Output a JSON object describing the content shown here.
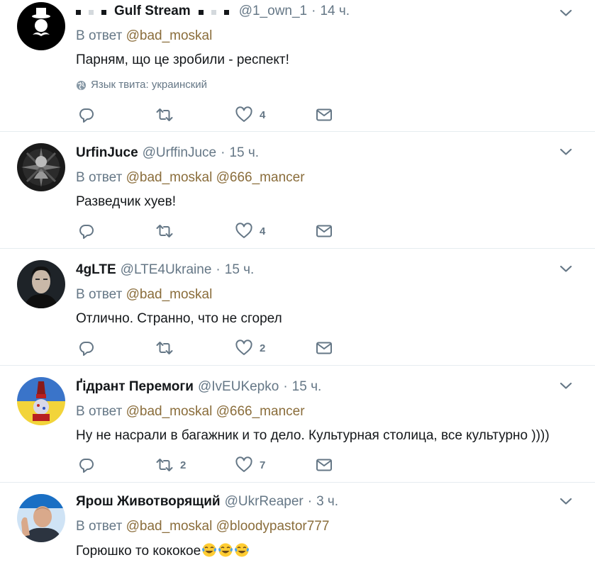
{
  "tweets": [
    {
      "fullname": "Gulf Stream",
      "username": "@1_own_1",
      "time": "14 ч.",
      "reply_prefix": "В ответ",
      "reply_mentions": "@bad_moskal",
      "text": "Парням, що це зробили - респект!",
      "lang_label": "Язык твита: украинский",
      "replies": "",
      "retweets": "",
      "likes": "4"
    },
    {
      "fullname": "UrfinJuce",
      "username": "@UrffinJuce",
      "time": "15 ч.",
      "reply_prefix": "В ответ",
      "reply_mentions": "@bad_moskal @666_mancer",
      "text": "Разведчик хуев!",
      "replies": "",
      "retweets": "",
      "likes": "4"
    },
    {
      "fullname": "4gLTE",
      "username": "@LTE4Ukraine",
      "time": "15 ч.",
      "reply_prefix": "В ответ",
      "reply_mentions": "@bad_moskal",
      "text": "Отлично. Странно, что не сгорел",
      "replies": "",
      "retweets": "",
      "likes": "2"
    },
    {
      "fullname": "Ґідрант Перемоги",
      "username": "@IvEUKepko",
      "time": "15 ч.",
      "reply_prefix": "В ответ",
      "reply_mentions": "@bad_moskal @666_mancer",
      "text": "Ну не насрали в багажник и то дело. Культурная столица, все культурно ))))",
      "replies": "",
      "retweets": "2",
      "likes": "7"
    },
    {
      "fullname": "Ярош Животворящий",
      "username": "@UkrReaper",
      "time": "3 ч.",
      "reply_prefix": "В ответ",
      "reply_mentions": "@bad_moskal @bloodypastor777",
      "text": "Горюшко то кококое"
    }
  ],
  "icons": {
    "reply": "reply-icon",
    "retweet": "retweet-icon",
    "like": "heart-icon",
    "dm": "envelope-icon",
    "more": "chevron-down-icon",
    "lang": "globe-icon",
    "emoji": "tears-of-joy-emoji"
  },
  "colors": {
    "text": "#14171a",
    "secondary": "#657786",
    "mention": "#8a6d3b",
    "divider": "#e6ecf0"
  }
}
